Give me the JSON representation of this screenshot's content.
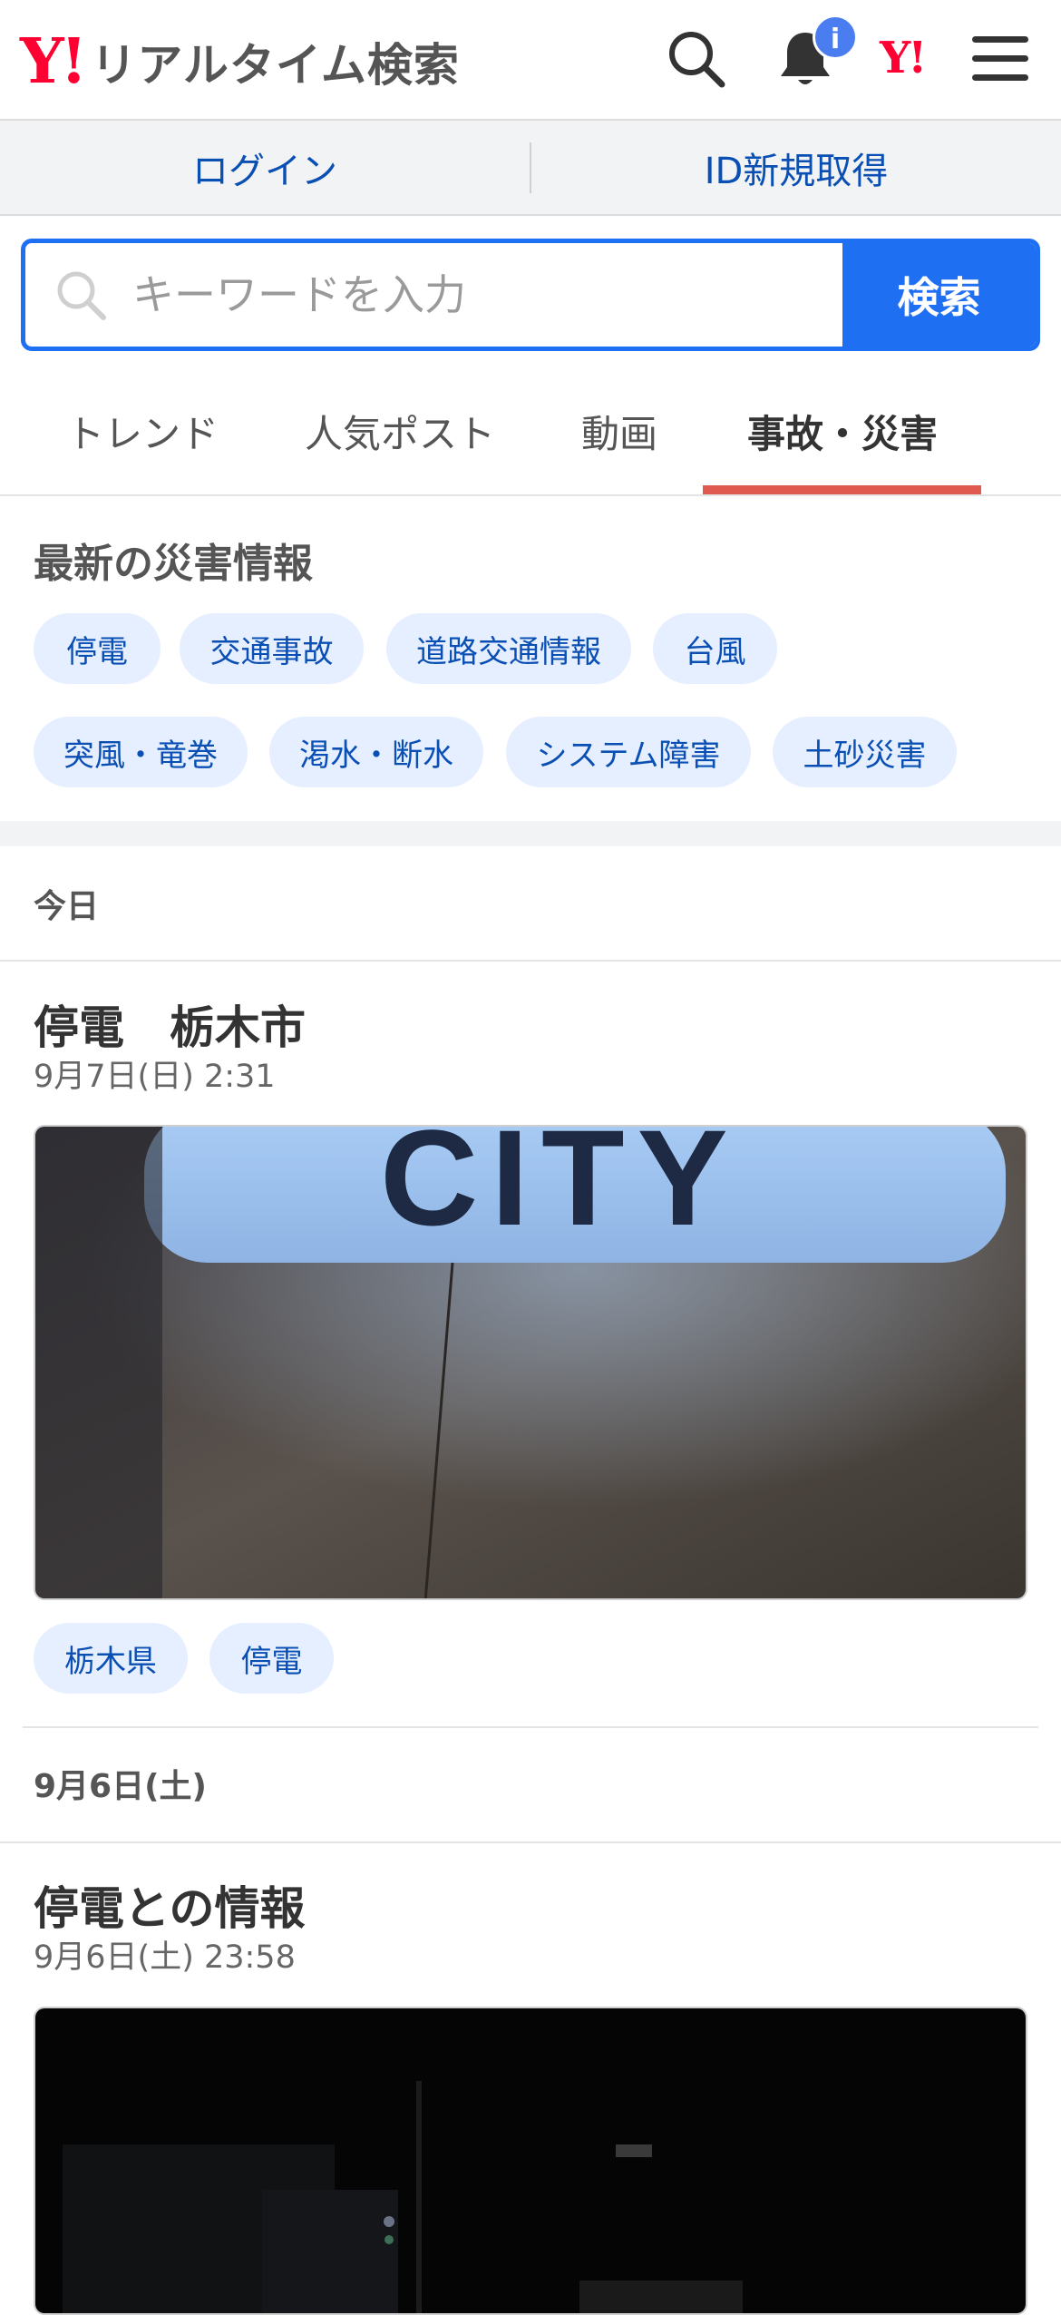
{
  "header": {
    "logo_mark": "Y!",
    "logo_text": "リアルタイム検索",
    "notification_badge": "i",
    "yahoo_mark": "Y!"
  },
  "login_bar": {
    "login_label": "ログイン",
    "register_label": "ID新規取得"
  },
  "search": {
    "placeholder": "キーワードを入力",
    "button_label": "検索"
  },
  "tabs": [
    {
      "label": "トレンド",
      "active": false
    },
    {
      "label": "人気ポスト",
      "active": false
    },
    {
      "label": "動画",
      "active": false
    },
    {
      "label": "事故・災害",
      "active": true
    }
  ],
  "disaster_section": {
    "title": "最新の災害情報",
    "chips": [
      "停電",
      "交通事故",
      "道路交通情報",
      "台風",
      "突風・竜巻",
      "渇水・断水",
      "システム障害",
      "土砂災害"
    ]
  },
  "timeline": [
    {
      "date_header": "今日",
      "title": "停電　栃木市",
      "time": "9月7日(日) 2:31",
      "image_text": "CITY",
      "tags": [
        "栃木県",
        "停電"
      ]
    },
    {
      "date_header": "9月6日(土)",
      "title": "停電との情報",
      "time": "9月6日(土) 23:58"
    }
  ],
  "colors": {
    "brand_red": "#ff0033",
    "accent_blue": "#1f6ff2",
    "link_blue": "#0a4fb3",
    "tab_underline": "#e05a4f",
    "chip_bg": "#e6efff"
  }
}
